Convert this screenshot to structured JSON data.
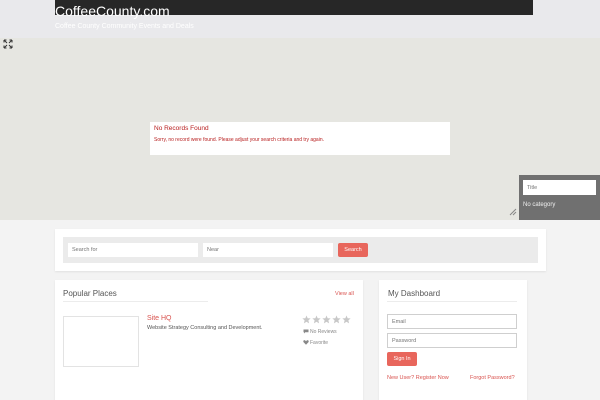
{
  "header": {
    "site_title": "CoffeeCounty.com",
    "tagline": "Coffee County Community Events and Deals"
  },
  "map": {
    "notice_title": "No Records Found",
    "notice_text": "Sorry, no record were found. Please adjust your search criteria and try again.",
    "filter_placeholder": "Title",
    "filter_category": "No category"
  },
  "search": {
    "search_for_placeholder": "Search for",
    "near_placeholder": "Near",
    "button_label": "Search"
  },
  "popular": {
    "title": "Popular Places",
    "view_all": "View all",
    "place": {
      "name": "Site HQ",
      "description": "Website Strategy Consulting and Development.",
      "rating_stars": 0,
      "rating_max": 5,
      "reviews_label": "No Reviews",
      "favorite_label": "Favorite"
    }
  },
  "dashboard": {
    "title": "My Dashboard",
    "email_placeholder": "Email",
    "password_placeholder": "Password",
    "signin_label": "Sign In",
    "register_link": "New User? Register Now",
    "forgot_link": "Forgot Password?"
  },
  "colors": {
    "accent": "#e8665c",
    "link": "#d9534f",
    "error_text": "#b71c1c",
    "header_dark": "#272727",
    "map_bg": "#e6e6e1"
  },
  "icons": {
    "map_expand": "expand-icon",
    "map_resize": "resize-handle-icon",
    "star": "star-icon",
    "reviews": "comment-icon",
    "favorite": "heart-icon"
  }
}
